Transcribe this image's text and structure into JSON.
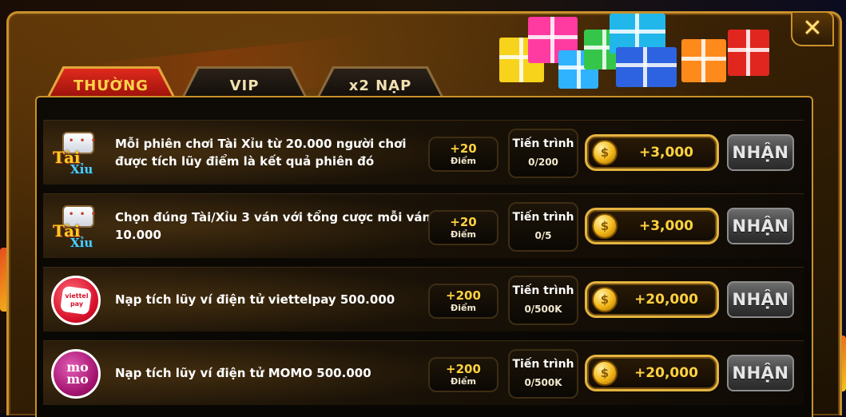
{
  "tabs": [
    {
      "label": "THƯỜNG",
      "active": true
    },
    {
      "label": "VIP",
      "active": false
    },
    {
      "label": "x2 NẠP",
      "active": false
    }
  ],
  "close_icon": "close-x-icon",
  "tasks": [
    {
      "icon": "tai-xiu-icon",
      "icon_text_top": "Tài",
      "icon_text_bottom": "Xỉu",
      "description": "Mỗi phiên chơi Tài Xỉu từ 20.000 người chơi được tích lũy điểm là kết quả phiên đó",
      "points_value": "+20",
      "points_label": "Điểm",
      "progress_label": "Tiến trình",
      "progress_value": "0/200",
      "reward": "+3,000",
      "claim_label": "NHẬN"
    },
    {
      "icon": "tai-xiu-icon",
      "icon_text_top": "Tài",
      "icon_text_bottom": "Xỉu",
      "description": "Chọn đúng Tài/Xỉu 3 ván với tổng cược mỗi ván 10.000",
      "points_value": "+20",
      "points_label": "Điểm",
      "progress_label": "Tiến trình",
      "progress_value": "0/5",
      "reward": "+3,000",
      "claim_label": "NHẬN"
    },
    {
      "icon": "viettelpay-icon",
      "icon_text_top": "viettel",
      "icon_text_bottom": "pay",
      "description": "Nạp tích lũy ví điện tử viettelpay 500.000",
      "points_value": "+200",
      "points_label": "Điểm",
      "progress_label": "Tiến trình",
      "progress_value": "0/500K",
      "reward": "+20,000",
      "claim_label": "NHẬN"
    },
    {
      "icon": "momo-icon",
      "icon_text_top": "mo",
      "icon_text_bottom": "mo",
      "description": "Nạp tích lũy ví điện tử MOMO 500.000",
      "points_value": "+200",
      "points_label": "Điểm",
      "progress_label": "Tiến trình",
      "progress_value": "0/500K",
      "reward": "+20,000",
      "claim_label": "NHẬN"
    }
  ],
  "colors": {
    "accent_gold": "#e4b43f",
    "active_tab_red": "#e02a1c",
    "reward_text": "#ffd23f"
  }
}
